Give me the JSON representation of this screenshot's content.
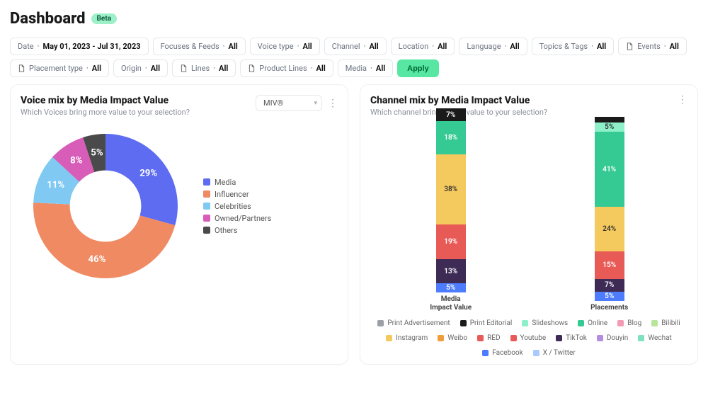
{
  "header": {
    "title": "Dashboard",
    "badge": "Beta"
  },
  "filters": [
    {
      "label": "Date",
      "value": "May 01, 2023 - Jul 31, 2023",
      "icon": null
    },
    {
      "label": "Focuses & Feeds",
      "value": "All",
      "icon": null
    },
    {
      "label": "Voice type",
      "value": "All",
      "icon": null
    },
    {
      "label": "Channel",
      "value": "All",
      "icon": null
    },
    {
      "label": "Location",
      "value": "All",
      "icon": null
    },
    {
      "label": "Language",
      "value": "All",
      "icon": null
    },
    {
      "label": "Topics & Tags",
      "value": "All",
      "icon": null
    },
    {
      "label": "Events",
      "value": "All",
      "icon": "doc"
    },
    {
      "label": "Placement type",
      "value": "All",
      "icon": "doc"
    },
    {
      "label": "Origin",
      "value": "All",
      "icon": null
    },
    {
      "label": "Lines",
      "value": "All",
      "icon": "doc"
    },
    {
      "label": "Product Lines",
      "value": "All",
      "icon": "doc"
    },
    {
      "label": "Media",
      "value": "All",
      "icon": null
    }
  ],
  "apply_label": "Apply",
  "voice_card": {
    "title": "Voice mix by Media Impact Value",
    "subtitle": "Which Voices bring more value to your selection?",
    "select_value": "MIV®"
  },
  "channel_card": {
    "title": "Channel mix by Media Impact Value",
    "subtitle": "Which channel brings more value to your selection?",
    "bar_labels": [
      "Media Impact Value",
      "Placements"
    ]
  },
  "chart_data": [
    {
      "type": "pie",
      "title": "Voice mix by Media Impact Value",
      "series": [
        {
          "name": "Media",
          "value": 29,
          "color": "#5d6cf0"
        },
        {
          "name": "Influencer",
          "value": 46,
          "color": "#f08a63"
        },
        {
          "name": "Celebrities",
          "value": 11,
          "color": "#7fc9f2"
        },
        {
          "name": "Owned/Partners",
          "value": 8,
          "color": "#d85db8"
        },
        {
          "name": "Others",
          "value": 5,
          "color": "#4a4a4a"
        }
      ],
      "value_unit": "%",
      "donut_hole_ratio": 0.5
    },
    {
      "type": "bar",
      "title": "Channel mix by Media Impact Value",
      "stacked": true,
      "orientation": "vertical",
      "value_unit": "%",
      "categories": [
        "Media Impact Value",
        "Placements"
      ],
      "series": [
        {
          "name": "Print Advertisement",
          "color": "#9aa0a6"
        },
        {
          "name": "Print Editorial",
          "color": "#1a1a1a"
        },
        {
          "name": "Slideshows",
          "color": "#8df0c9"
        },
        {
          "name": "Online",
          "color": "#35c993"
        },
        {
          "name": "Blog",
          "color": "#f29bb5"
        },
        {
          "name": "Bilibili",
          "color": "#b9e59a"
        },
        {
          "name": "Instagram",
          "color": "#f4c95d"
        },
        {
          "name": "Weibo",
          "color": "#f29b3a"
        },
        {
          "name": "RED",
          "color": "#e85a56"
        },
        {
          "name": "Youtube",
          "color": "#e85a56"
        },
        {
          "name": "TikTok",
          "color": "#3d2b56"
        },
        {
          "name": "Douyin",
          "color": "#b48ce0"
        },
        {
          "name": "Wechat",
          "color": "#7fe0c2"
        },
        {
          "name": "Facebook",
          "color": "#4d7cff"
        },
        {
          "name": "X / Twitter",
          "color": "#aac9ff"
        }
      ],
      "visible_segments": {
        "Media Impact Value": [
          {
            "series": "Facebook",
            "value": 5,
            "color": "#4d7cff"
          },
          {
            "series": "TikTok",
            "value": 13,
            "color": "#3d2b56"
          },
          {
            "series": "Youtube",
            "value": 19,
            "color": "#e85a56"
          },
          {
            "series": "Instagram",
            "value": 38,
            "color": "#f4c95d"
          },
          {
            "series": "Online",
            "value": 18,
            "color": "#35c993"
          },
          {
            "series": "Print Editorial",
            "value": 7,
            "color": "#1a1a1a"
          }
        ],
        "Placements": [
          {
            "series": "Facebook",
            "value": 5,
            "color": "#4d7cff"
          },
          {
            "series": "TikTok",
            "value": 7,
            "color": "#3d2b56"
          },
          {
            "series": "Youtube",
            "value": 15,
            "color": "#e85a56"
          },
          {
            "series": "Instagram",
            "value": 24,
            "color": "#f4c95d"
          },
          {
            "series": "Online",
            "value": 41,
            "color": "#35c993"
          },
          {
            "series": "Slideshows",
            "value": 5,
            "color": "#8df0c9"
          },
          {
            "series": "Print Editorial",
            "value": 3,
            "color": "#1a1a1a"
          }
        ]
      },
      "legend": [
        "Print Advertisement",
        "Print Editorial",
        "Slideshows",
        "Online",
        "Blog",
        "Bilibili",
        "Instagram",
        "Weibo",
        "RED",
        "Youtube",
        "TikTok",
        "Douyin",
        "Wechat",
        "Facebook",
        "X / Twitter"
      ]
    }
  ]
}
